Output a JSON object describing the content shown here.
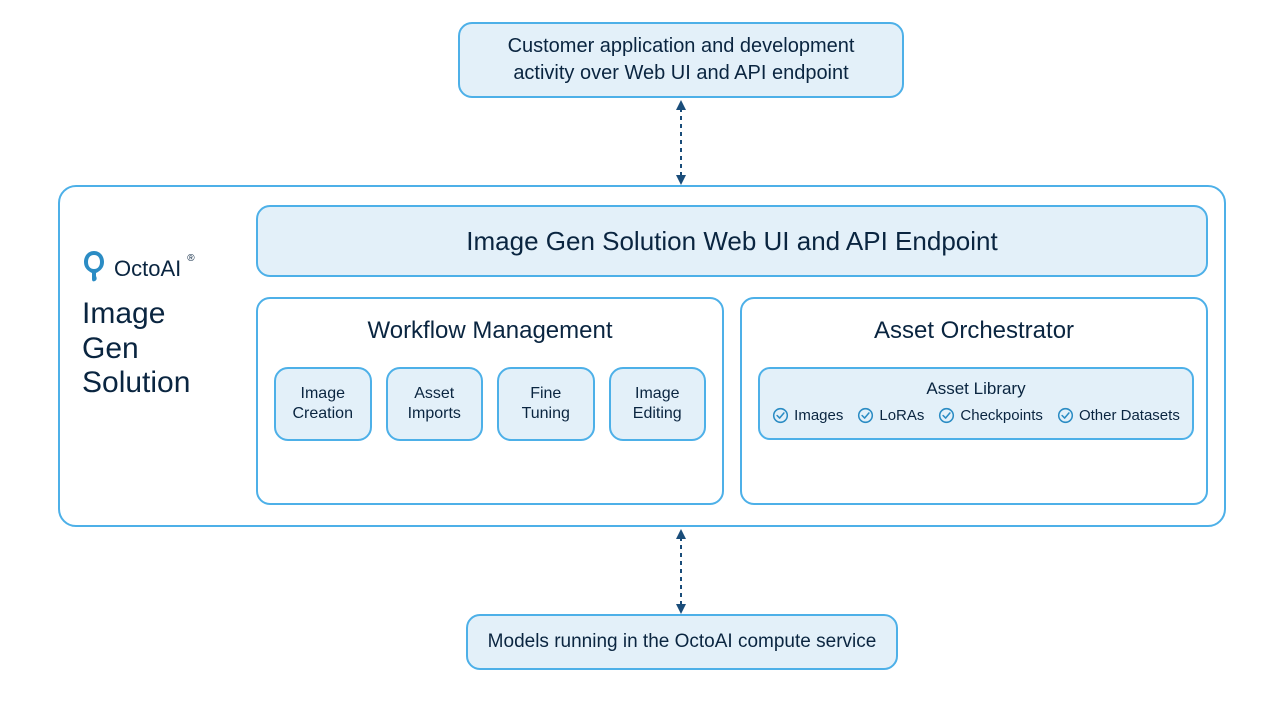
{
  "top_box": "Customer application and development activity over Web UI and API endpoint",
  "brand": {
    "name": "OctoAI",
    "subtitle_l1": "Image",
    "subtitle_l2": "Gen",
    "subtitle_l3": "Solution"
  },
  "api_box": "Image Gen Solution Web UI and API Endpoint",
  "workflow": {
    "title": "Workflow Management",
    "items": [
      "Image Creation",
      "Asset Imports",
      "Fine Tuning",
      "Image Editing"
    ]
  },
  "asset": {
    "title": "Asset Orchestrator",
    "library_title": "Asset Library",
    "library_items": [
      "Images",
      "LoRAs",
      "Checkpoints",
      "Other Datasets"
    ]
  },
  "bottom_box": "Models running in the OctoAI compute service",
  "colors": {
    "border": "#4db0e8",
    "fill": "#e3f0f9",
    "text": "#0a2540",
    "arrow": "#1a4d7a"
  }
}
